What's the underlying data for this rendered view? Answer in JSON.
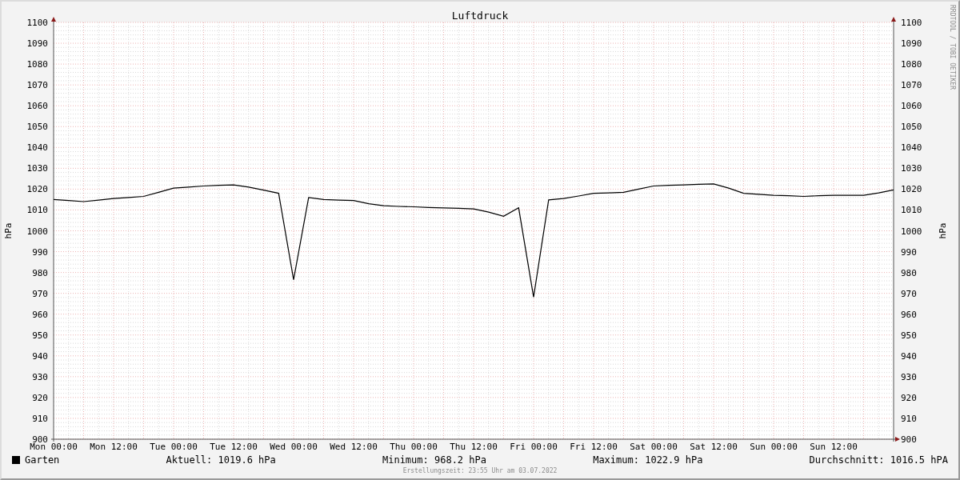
{
  "chart": {
    "chart_data": {
      "type": "line",
      "title": "Luftdruck",
      "ylabel": "hPa",
      "categories": [
        "Mon 00:00",
        null,
        null,
        null,
        "Mon 12:00",
        null,
        null,
        null,
        "Tue 00:00",
        null,
        null,
        null,
        "Tue 12:00",
        null,
        null,
        null,
        "Wed 00:00",
        null,
        null,
        null,
        "Wed 12:00",
        null,
        null,
        null,
        "Thu 00:00",
        null,
        null,
        null,
        "Thu 12:00",
        null,
        null,
        null,
        "Fri 00:00",
        null,
        null,
        null,
        "Fri 12:00",
        null,
        null,
        null,
        "Sat 00:00",
        null,
        null,
        null,
        "Sat 12:00",
        null,
        null,
        null,
        "Sun 00:00",
        null,
        null,
        null,
        "Sun 12:00",
        null,
        null,
        null,
        null
      ],
      "series": [
        {
          "name": "Garten",
          "color": "#000000",
          "values": [
            1015,
            1014.5,
            1014,
            1014.7,
            1015.5,
            1016,
            1016.5,
            1018.5,
            1020.5,
            1021,
            1021.5,
            1021.8,
            1022,
            1021,
            1019.5,
            1018,
            976.5,
            1016,
            1015,
            1014.7,
            1014.5,
            1013,
            1012,
            1011.7,
            1011.5,
            1011.2,
            1011,
            1010.8,
            1010.5,
            1009,
            1007,
            1011,
            968.2,
            1014.8,
            1015.5,
            1016.7,
            1018,
            1018.2,
            1018.5,
            1020,
            1021.5,
            1021.8,
            1022,
            1022.3,
            1022.5,
            1020.5,
            1018,
            1017.5,
            1017,
            1016.8,
            1016.5,
            1016.8,
            1017,
            1017,
            1017,
            1018.2,
            1019.6
          ]
        }
      ],
      "ylim": [
        900,
        1100
      ],
      "grid": true,
      "yticks": [
        900,
        910,
        920,
        930,
        940,
        950,
        960,
        970,
        980,
        990,
        1000,
        1010,
        1020,
        1030,
        1040,
        1050,
        1060,
        1070,
        1080,
        1090,
        1100
      ]
    },
    "right_axis": {
      "ylabel": "hPa",
      "ticks": [
        "1100",
        "1090",
        "1080",
        "1070",
        "1060",
        "1050",
        "1040",
        "1030",
        "1020",
        "1010",
        "1000",
        "990",
        "980",
        "970",
        "960",
        "950",
        "940",
        "930",
        "920",
        "910",
        "900"
      ]
    },
    "watermark": "RRDTOOL / TOBI OETIKER"
  },
  "legend": {
    "stats": [
      "Aktuell: 1019.6 hPa",
      "Minimum: 968.2 hPa",
      "Maximum: 1022.9 hPa",
      "Durchschnitt: 1016.5 hPA"
    ]
  },
  "footer": "Erstellungszeit: 23:55 Uhr am 03.07.2022"
}
